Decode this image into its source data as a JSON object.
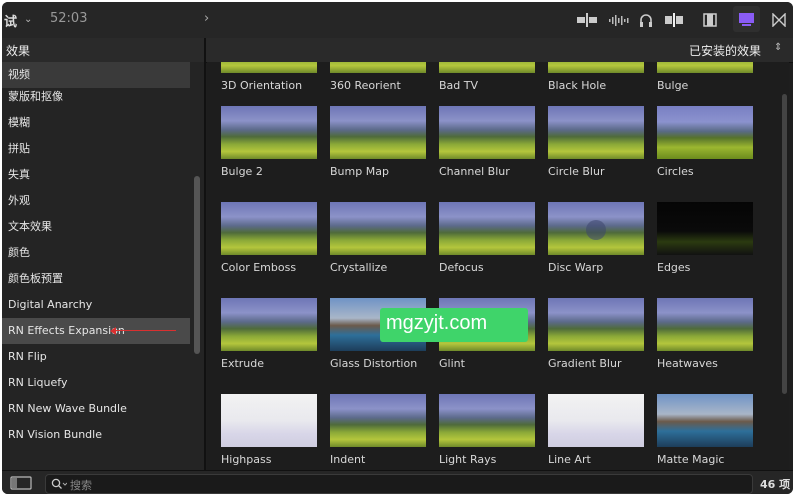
{
  "header": {
    "title_fragment": "试",
    "timecode": "52:03",
    "panel_title": "效果",
    "filter_label": "已安装的效果"
  },
  "sidebar": {
    "items": [
      {
        "label": "视频"
      },
      {
        "label": "蒙版和抠像"
      },
      {
        "label": "模糊"
      },
      {
        "label": "拼贴"
      },
      {
        "label": "失真"
      },
      {
        "label": "外观"
      },
      {
        "label": "文本效果"
      },
      {
        "label": "颜色"
      },
      {
        "label": "颜色板预置"
      },
      {
        "label": "Digital Anarchy"
      },
      {
        "label": "RN Effects Expansion"
      },
      {
        "label": "RN Flip"
      },
      {
        "label": "RN Liquefy"
      },
      {
        "label": "RN New Wave Bundle"
      },
      {
        "label": "RN Vision Bundle"
      }
    ],
    "selected": "RN Effects Expansion"
  },
  "effects": [
    {
      "label": "3D Orientation"
    },
    {
      "label": "360 Reorient"
    },
    {
      "label": "Bad TV"
    },
    {
      "label": "Black Hole"
    },
    {
      "label": "Bulge"
    },
    {
      "label": "Bulge 2"
    },
    {
      "label": "Bump Map"
    },
    {
      "label": "Channel Blur"
    },
    {
      "label": "Circle Blur"
    },
    {
      "label": "Circles"
    },
    {
      "label": "Color Emboss"
    },
    {
      "label": "Crystallize"
    },
    {
      "label": "Defocus"
    },
    {
      "label": "Disc Warp"
    },
    {
      "label": "Edges"
    },
    {
      "label": "Extrude"
    },
    {
      "label": "Glass Distortion"
    },
    {
      "label": "Glint"
    },
    {
      "label": "Gradient Blur"
    },
    {
      "label": "Heatwaves"
    },
    {
      "label": "Highpass"
    },
    {
      "label": "Indent"
    },
    {
      "label": "Light Rays"
    },
    {
      "label": "Line Art"
    },
    {
      "label": "Matte Magic"
    }
  ],
  "search": {
    "placeholder": "搜索"
  },
  "footer": {
    "count": "46 项"
  },
  "watermark": {
    "text": "mgzyjt.com"
  },
  "colors": {
    "accent": "#8a5cf6",
    "selected_row": "#4a4a4a",
    "watermark_bg": "#3fd46a"
  }
}
